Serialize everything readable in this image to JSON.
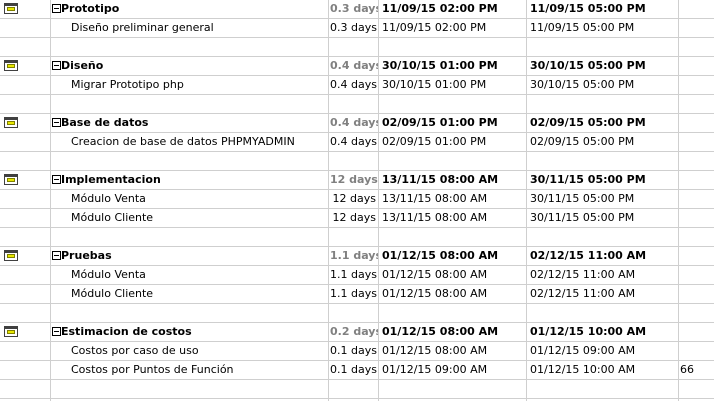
{
  "colors": {
    "grid_line": "#cfcfcf",
    "summary_duration": "#808080",
    "icon_bar": "#e8e800"
  },
  "rows": [
    {
      "type": "summary",
      "name": "Prototipo",
      "duration": "0.3 days",
      "start": "11/09/15 02:00 PM",
      "finish": "11/09/15 05:00 PM",
      "extra": ""
    },
    {
      "type": "sub",
      "name": "Diseño preliminar general",
      "duration": "0.3 days",
      "start": "11/09/15 02:00 PM",
      "finish": "11/09/15 05:00 PM",
      "extra": ""
    },
    {
      "type": "blank"
    },
    {
      "type": "summary",
      "name": "Diseño",
      "duration": "0.4 days",
      "start": "30/10/15 01:00 PM",
      "finish": "30/10/15 05:00 PM",
      "extra": ""
    },
    {
      "type": "sub",
      "name": "Migrar Prototipo php",
      "duration": "0.4 days",
      "start": "30/10/15 01:00 PM",
      "finish": "30/10/15 05:00 PM",
      "extra": ""
    },
    {
      "type": "blank"
    },
    {
      "type": "summary",
      "name": "Base de datos",
      "duration": "0.4 days",
      "start": "02/09/15 01:00 PM",
      "finish": "02/09/15 05:00 PM",
      "extra": ""
    },
    {
      "type": "sub",
      "name": "Creacion de base de datos  PHPMYADMIN",
      "duration": "0.4 days",
      "start": "02/09/15 01:00 PM",
      "finish": "02/09/15 05:00 PM",
      "extra": ""
    },
    {
      "type": "blank"
    },
    {
      "type": "summary",
      "name": "Implementacion",
      "duration": "12 days",
      "start": "13/11/15 08:00 AM",
      "finish": "30/11/15 05:00 PM",
      "extra": ""
    },
    {
      "type": "sub",
      "name": "Módulo Venta",
      "duration": "12 days",
      "start": "13/11/15 08:00 AM",
      "finish": "30/11/15 05:00 PM",
      "extra": ""
    },
    {
      "type": "sub",
      "name": "Módulo Cliente",
      "duration": "12 days",
      "start": "13/11/15 08:00 AM",
      "finish": "30/11/15 05:00 PM",
      "extra": ""
    },
    {
      "type": "blank"
    },
    {
      "type": "summary",
      "name": "Pruebas",
      "duration": "1.1 days",
      "start": "01/12/15 08:00 AM",
      "finish": "02/12/15 11:00 AM",
      "extra": ""
    },
    {
      "type": "sub",
      "name": "Módulo Venta",
      "duration": "1.1 days",
      "start": "01/12/15 08:00 AM",
      "finish": "02/12/15 11:00 AM",
      "extra": ""
    },
    {
      "type": "sub",
      "name": "Módulo Cliente",
      "duration": "1.1 days",
      "start": "01/12/15 08:00 AM",
      "finish": "02/12/15 11:00 AM",
      "extra": ""
    },
    {
      "type": "blank"
    },
    {
      "type": "summary",
      "name": "Estimacion de costos",
      "duration": "0.2 days",
      "start": "01/12/15 08:00 AM",
      "finish": "01/12/15 10:00 AM",
      "extra": ""
    },
    {
      "type": "sub",
      "name": "Costos por caso de uso",
      "duration": "0.1 days",
      "start": "01/12/15 08:00 AM",
      "finish": "01/12/15 09:00 AM",
      "extra": ""
    },
    {
      "type": "sub",
      "name": "Costos por Puntos de Función",
      "duration": "0.1 days",
      "start": "01/12/15 09:00 AM",
      "finish": "01/12/15 10:00 AM",
      "extra": "66"
    },
    {
      "type": "blank"
    }
  ]
}
